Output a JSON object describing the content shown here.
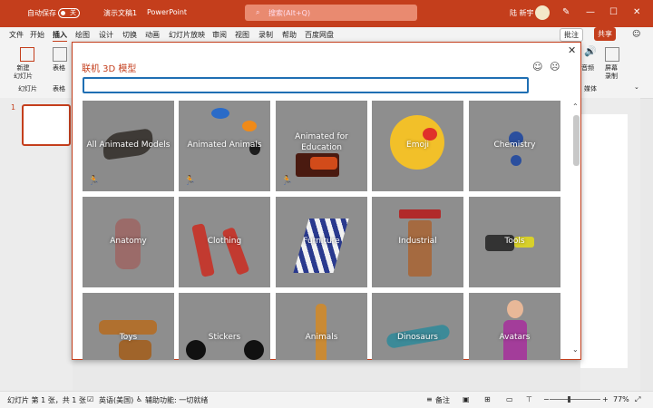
{
  "titlebar": {
    "autosave_label": "自动保存",
    "autosave_state": "关",
    "doc_title": "演示文稿1",
    "app_name": "PowerPoint",
    "search_placeholder": "搜索(Alt+Q)",
    "user_name": "陆 新宇"
  },
  "tabs": [
    "文件",
    "开始",
    "插入",
    "绘图",
    "设计",
    "切换",
    "动画",
    "幻灯片放映",
    "审阅",
    "视图",
    "录制",
    "帮助",
    "百度网盘"
  ],
  "active_tab": "插入",
  "tab_actions": {
    "comments": "批注",
    "share": "共享"
  },
  "ribbon": {
    "new_slide": "新建\n幻灯片",
    "table": "表格",
    "group_slides": "幻灯片",
    "group_tables": "表格",
    "audio": "音频",
    "screen_record": "屏幕\n录制",
    "group_media": "媒体"
  },
  "dialog": {
    "title": "联机 3D 模型",
    "search_value": "",
    "categories": [
      {
        "label": "All Animated Models",
        "animated": true
      },
      {
        "label": "Animated Animals",
        "animated": true
      },
      {
        "label": "Animated for Education",
        "animated": true
      },
      {
        "label": "Emoji",
        "animated": false
      },
      {
        "label": "Chemistry",
        "animated": false
      },
      {
        "label": "Anatomy",
        "animated": false
      },
      {
        "label": "Clothing",
        "animated": false
      },
      {
        "label": "Furniture",
        "animated": false
      },
      {
        "label": "Industrial",
        "animated": false
      },
      {
        "label": "Tools",
        "animated": false
      },
      {
        "label": "Toys",
        "animated": false
      },
      {
        "label": "Stickers",
        "animated": false
      },
      {
        "label": "Animals",
        "animated": false
      },
      {
        "label": "Dinosaurs",
        "animated": false
      },
      {
        "label": "Avatars",
        "animated": false
      }
    ]
  },
  "thumbnails": {
    "slide_number": "1"
  },
  "statusbar": {
    "slide_info": "幻灯片 第 1 张，共 1 张",
    "language": "英语(美国)",
    "accessibility": "辅助功能: 一切就绪",
    "notes": "备注",
    "zoom": "77%"
  }
}
